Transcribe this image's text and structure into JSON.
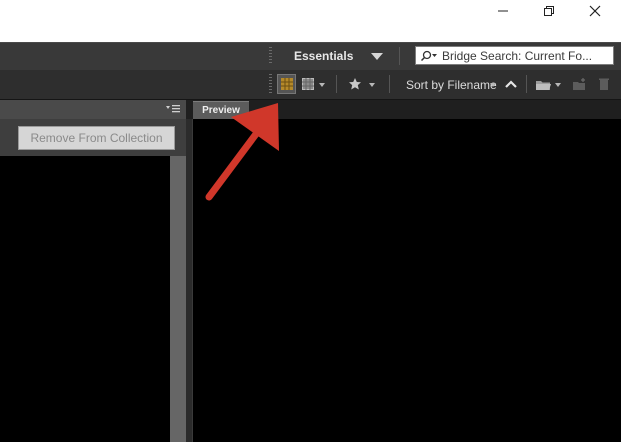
{
  "window": {
    "controls": {
      "minimize_icon": "minimize-icon",
      "maximize_icon": "restore-icon",
      "close_icon": "close-icon"
    }
  },
  "toolbar": {
    "workspace_label": "Essentials",
    "search_placeholder": "Bridge Search: Current Fo...",
    "sort_label": "Sort by Filename"
  },
  "left_panel": {
    "remove_button_label": "Remove From Collection"
  },
  "preview_panel": {
    "tab_label": "Preview"
  },
  "colors": {
    "app_bar": "#393939",
    "annotation_arrow": "#d0372a",
    "thumbnail_mode_active": "#b58a2a"
  }
}
